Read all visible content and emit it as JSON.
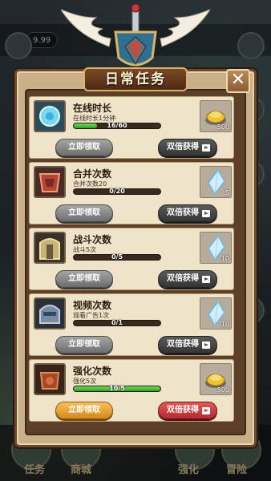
{
  "background": {
    "coin_value": "9.99",
    "tabs": [
      "任务",
      "商城",
      "强化",
      "冒险"
    ]
  },
  "dialog": {
    "title": "日常任务",
    "close_icon": "close-icon"
  },
  "tasks": [
    {
      "name": "在线时长",
      "desc": "在线时长1分钟",
      "progress_text": "16/60",
      "progress_fraction": 0.27,
      "reward_count": "500",
      "reward_icon": "gold-coins-icon",
      "claim_label": "立即领取",
      "double_label": "双倍获得",
      "claimable": false
    },
    {
      "name": "合并次数",
      "desc": "合并次数20",
      "progress_text": "0/20",
      "progress_fraction": 0.0,
      "reward_count": "5",
      "reward_icon": "crystal-icon",
      "claim_label": "立即领取",
      "double_label": "双倍获得",
      "claimable": false
    },
    {
      "name": "战斗次数",
      "desc": "战斗5次",
      "progress_text": "0/5",
      "progress_fraction": 0.0,
      "reward_count": "10",
      "reward_icon": "crystal-icon",
      "claim_label": "立即领取",
      "double_label": "双倍获得",
      "claimable": false
    },
    {
      "name": "视频次数",
      "desc": "观看广告1次",
      "progress_text": "0/1",
      "progress_fraction": 0.0,
      "reward_count": "10",
      "reward_icon": "crystal-icon",
      "claim_label": "立即领取",
      "double_label": "双倍获得",
      "claimable": false
    },
    {
      "name": "强化次数",
      "desc": "强化5次",
      "progress_text": "10/5",
      "progress_fraction": 1.0,
      "reward_count": "500",
      "reward_icon": "gold-coins-icon",
      "claim_label": "立即领取",
      "double_label": "双倍获得",
      "claimable": true
    }
  ]
}
